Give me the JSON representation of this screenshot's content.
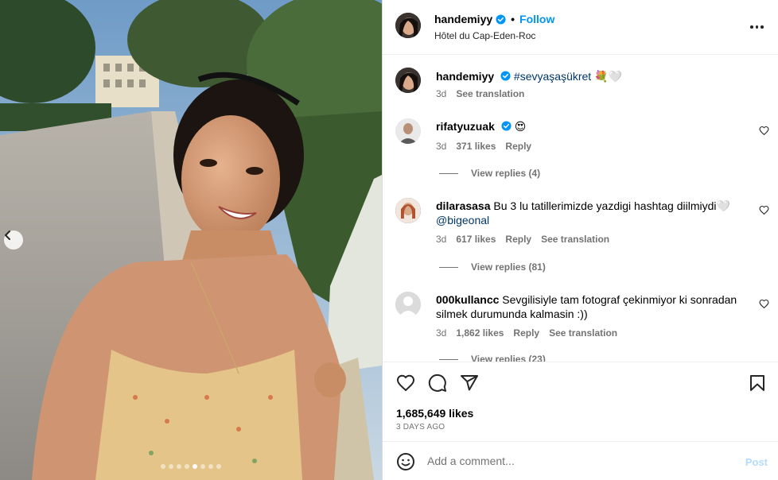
{
  "post": {
    "author": "handemiyy",
    "follow_label": "Follow",
    "location": "Hôtel du Cap-Eden-Roc",
    "separator": "•"
  },
  "caption": {
    "username": "handemiyy",
    "text": "#sevyaşaşükret",
    "emoji": "💐🤍",
    "time": "3d",
    "see_translation": "See translation"
  },
  "comments": [
    {
      "username": "rifatyuzuak",
      "text": "😍",
      "time": "3d",
      "likes": "371 likes",
      "reply": "Reply",
      "view_replies": "View replies (4)"
    },
    {
      "username": "dilarasasa",
      "text": "Bu 3 lu tatillerimizde yazdigi hashtag diilmiydi🤍",
      "mention": "@bigeonal",
      "time": "3d",
      "likes": "617 likes",
      "reply": "Reply",
      "see_translation": "See translation",
      "view_replies": "View replies (81)"
    },
    {
      "username": "000kullancc",
      "text": "Sevgilisiyle tam fotograf çekinmiyor ki sonradan silmek durumunda kalmasin :))",
      "time": "3d",
      "likes": "1,862 likes",
      "reply": "Reply",
      "see_translation": "See translation",
      "view_replies": "View replies (23)"
    }
  ],
  "stats": {
    "likes": "1,685,649 likes",
    "date": "3 DAYS AGO"
  },
  "add_comment": {
    "placeholder": "Add a comment...",
    "post_label": "Post"
  },
  "colors": {
    "accent": "#0095f6",
    "verified": "#0095f6",
    "muted": "#737373",
    "hashtag": "#00376b",
    "post_disabled": "#b3dbff"
  },
  "icons": {
    "like": "heart-icon",
    "comment": "comment-bubble-icon",
    "share": "paper-plane-icon",
    "save": "bookmark-icon",
    "more": "more-horizontal-icon",
    "emoji": "smiley-icon",
    "carousel_prev": "chevron-left-icon"
  },
  "carousel": {
    "slide_count": 8,
    "active_slide": 4
  }
}
